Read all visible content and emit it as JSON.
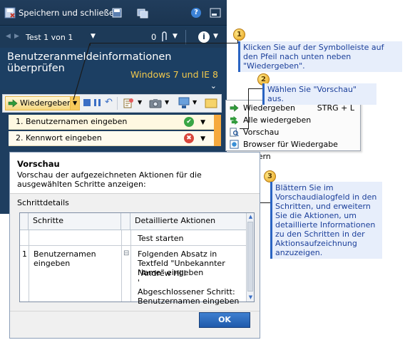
{
  "runner": {
    "save_close_label": "Speichern und schließen",
    "test_nav": "Test 1 von 1",
    "attachment_count": "0",
    "heading": "Benutzeranmeldeinformationen überprüfen",
    "configuration": "Windows 7 und IE 8",
    "play_button": "Wiedergeben",
    "steps": [
      {
        "label": "1. Benutzernamen eingeben",
        "status": "passed"
      },
      {
        "label": "2. Kennwort eingeben",
        "status": "failed"
      }
    ]
  },
  "menu": {
    "items": [
      {
        "label": "Wiedergeben",
        "shortcut": "STRG + L",
        "icon": "play-icon"
      },
      {
        "label": "Alle wiedergeben",
        "icon": "play-all-icon"
      },
      {
        "label": "Vorschau",
        "icon": "preview-icon"
      },
      {
        "label": "Browser für Wiedergabe ändern",
        "icon": "browser-icon"
      }
    ]
  },
  "callouts": [
    {
      "num": "1",
      "text": "Klicken Sie auf der Symbolleiste auf den Pfeil nach unten neben \"Wiedergeben\"."
    },
    {
      "num": "2",
      "text": "Wählen Sie \"Vorschau\" aus."
    },
    {
      "num": "3",
      "text": "Blättern Sie im Vorschaudialogfeld in den Schritten, und erweitern Sie die Aktionen, um detaillierte Informationen zu den Schritten in der Aktionsaufzeichnung anzuzeigen."
    }
  ],
  "dialog": {
    "title": "Vorschau",
    "description": "Vorschau der aufgezeichneten Aktionen für die ausgewählten Schritte anzeigen:",
    "details_label": "Schrittdetails",
    "col_steps": "Schritte",
    "col_actions": "Detaillierte Aktionen",
    "row0_action": "Test starten",
    "row1_num": "1",
    "row1_step": "Benutzernamen eingeben",
    "row1_expander": "⊟",
    "row1_actions": [
      "Folgenden Absatz in Textfeld \"Unbekannter Name\" eingeben",
      "\"Andrew Hill",
      "'",
      "Abgeschlossener Schritt: Benutzernamen eingeben"
    ],
    "ok_label": "OK"
  },
  "colors": {
    "runner_bg": "#1c3f63",
    "accent_yellow": "#f2c94c",
    "callout_blue": "#2a64c2",
    "ok_blue": "#2a6bc4"
  }
}
